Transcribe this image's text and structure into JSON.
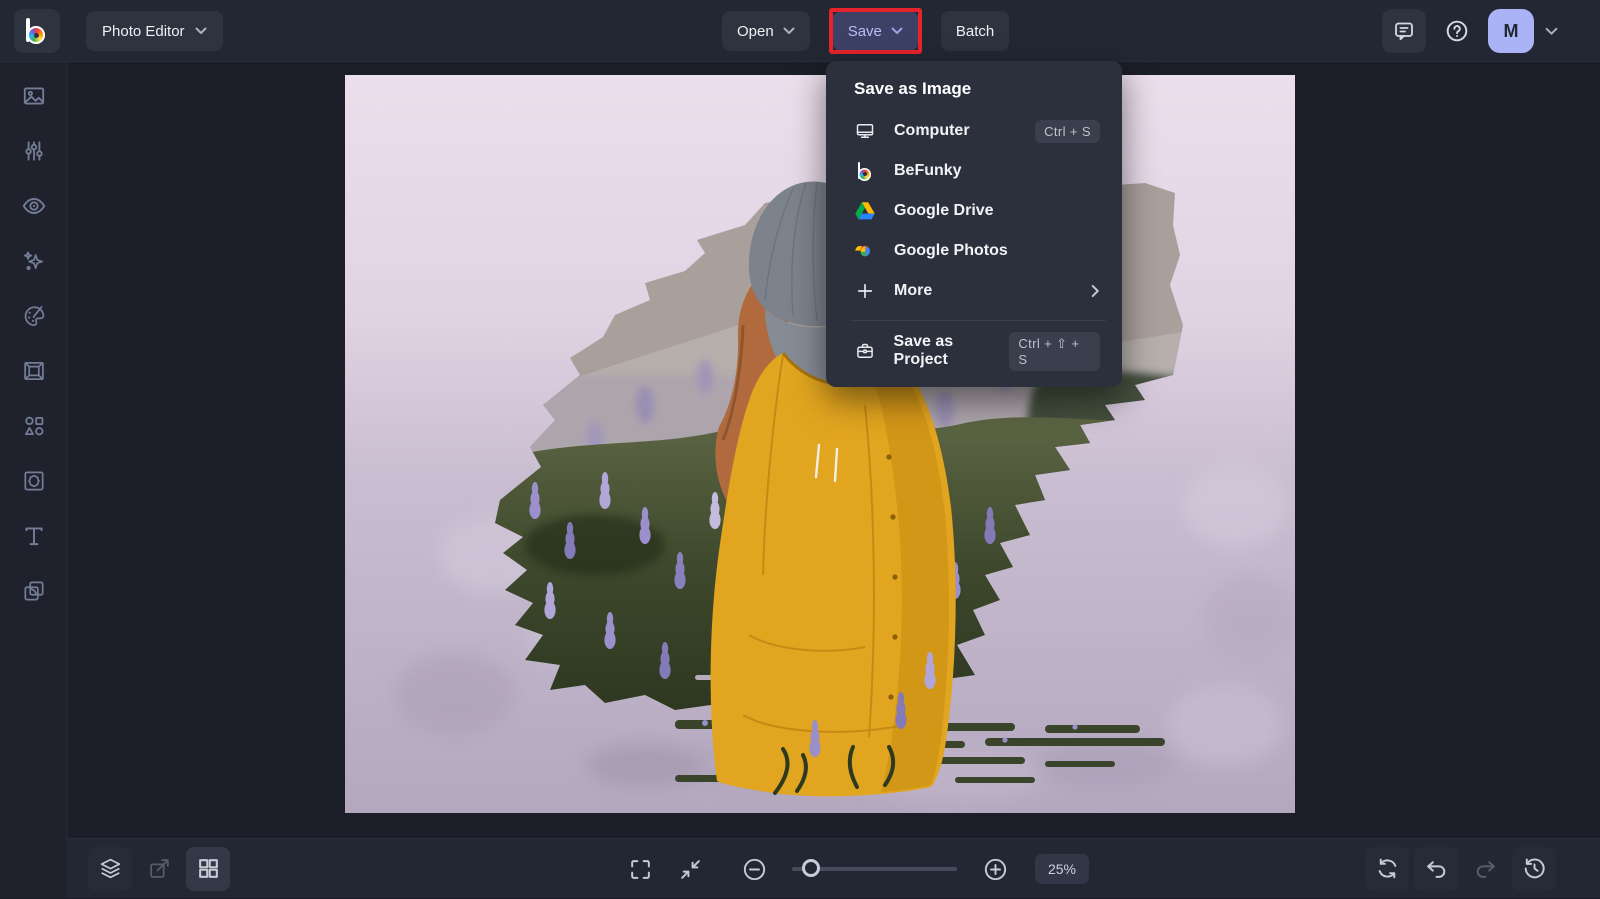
{
  "header": {
    "app_button_label": "Photo Editor",
    "open_label": "Open",
    "save_label": "Save",
    "batch_label": "Batch",
    "avatar_initial": "M"
  },
  "save_menu": {
    "section_title": "Save as Image",
    "items": [
      {
        "label": "Computer",
        "shortcut": "Ctrl + S",
        "icon": "computer-icon"
      },
      {
        "label": "BeFunky",
        "icon": "befunky-icon"
      },
      {
        "label": "Google Drive",
        "icon": "google-drive-icon"
      },
      {
        "label": "Google Photos",
        "icon": "google-photos-icon"
      },
      {
        "label": "More",
        "icon": "plus-icon",
        "has_submenu": true
      }
    ],
    "project_item": {
      "label": "Save as Project",
      "shortcut": "Ctrl + ⇧ + S",
      "icon": "briefcase-icon"
    }
  },
  "sidebar": {
    "items": [
      {
        "icon": "photo-edit-icon"
      },
      {
        "icon": "adjust-sliders-icon"
      },
      {
        "icon": "touchup-eye-icon"
      },
      {
        "icon": "effects-sparkles-icon"
      },
      {
        "icon": "artsy-palette-icon"
      },
      {
        "icon": "frames-icon"
      },
      {
        "icon": "graphics-shapes-icon"
      },
      {
        "icon": "overlays-icon"
      },
      {
        "icon": "text-icon"
      },
      {
        "icon": "textures-icon"
      }
    ]
  },
  "footer": {
    "zoom_level": "25%",
    "icons_left": [
      "layers-icon",
      "transform-icon",
      "templates-grid-icon"
    ],
    "icons_center": [
      "fullscreen-icon",
      "fit-screen-icon",
      "zoom-out-icon",
      "zoom-in-icon"
    ],
    "icons_right": [
      "reset-icon",
      "undo-icon",
      "redo-icon",
      "history-icon"
    ]
  },
  "annotation": {
    "highlight_color": "#E7242B",
    "highlighted_control": "save-button"
  },
  "colors": {
    "topbar_bg": "#232734",
    "save_button_bg": "#3D4166",
    "save_button_text": "#B9BEF4",
    "avatar_bg": "#A9B3F6",
    "menu_bg": "#2C2F3C"
  }
}
